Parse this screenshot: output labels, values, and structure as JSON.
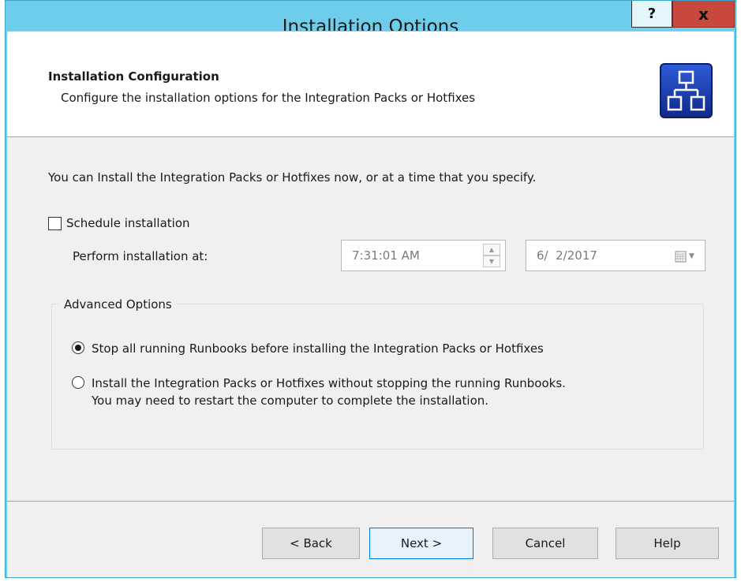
{
  "window": {
    "title": "Installation Options",
    "help_label": "?",
    "close_label": "x"
  },
  "header": {
    "title": "Installation Configuration",
    "subtitle": "Configure the installation options for the Integration Packs or Hotfixes",
    "icon": "network-diagram-icon"
  },
  "body": {
    "intro": "You can Install the Integration Packs or Hotfixes now, or at a time that you specify.",
    "schedule_checkbox": {
      "label": "Schedule installation",
      "checked": false
    },
    "perform_label": "Perform installation at:",
    "time_value": "7:31:01 AM",
    "date_value": "6/  2/2017"
  },
  "advanced": {
    "legend": "Advanced Options",
    "options": [
      {
        "label": "Stop all running Runbooks before installing the Integration Packs or Hotfixes",
        "selected": true
      },
      {
        "label": "Install the Integration Packs or Hotfixes without stopping the running Runbooks.",
        "label_line2": "You may need to restart the computer to complete the installation.",
        "selected": false
      }
    ]
  },
  "buttons": {
    "back": "< Back",
    "next": "Next >",
    "cancel": "Cancel",
    "help": "Help"
  },
  "colors": {
    "titlebar": "#6fcdec",
    "close_button": "#c9483d",
    "default_button_border": "#0078d7"
  }
}
